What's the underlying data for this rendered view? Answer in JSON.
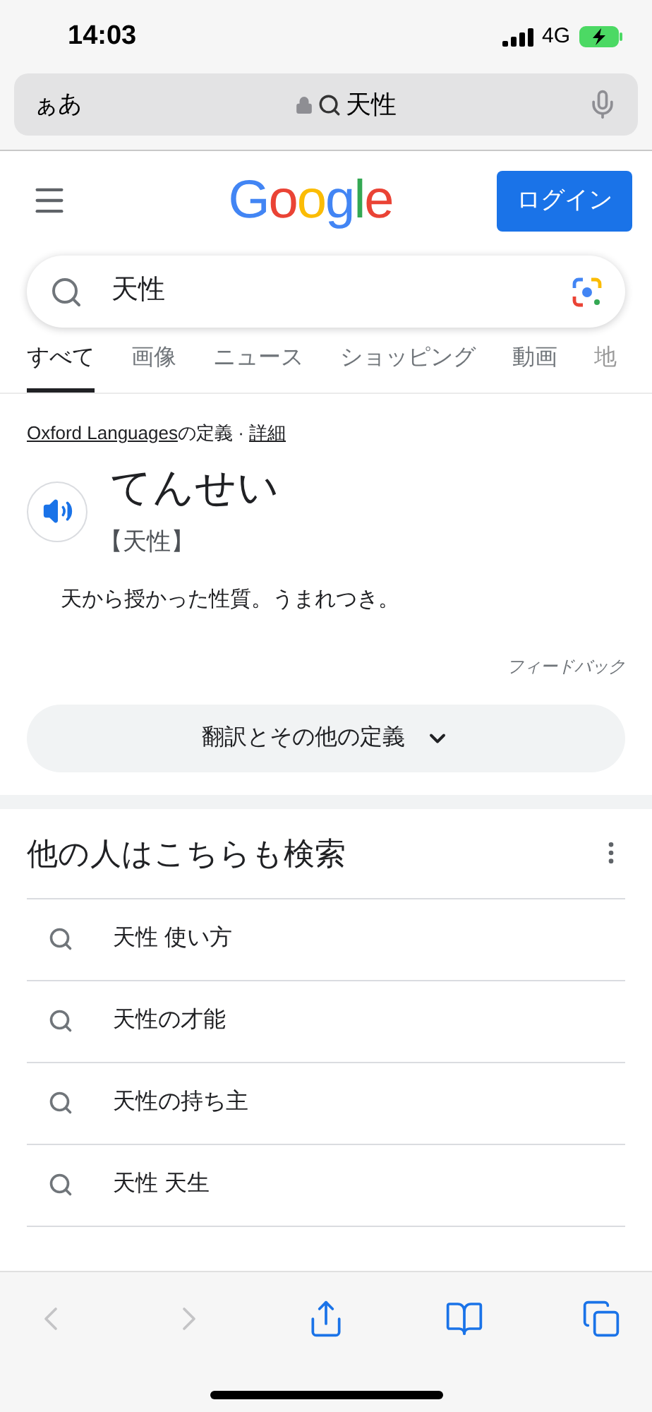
{
  "status_bar": {
    "time": "14:03",
    "network": "4G"
  },
  "address_bar": {
    "text_size_button": "ぁあ",
    "url_text": "天性"
  },
  "header": {
    "logo": [
      {
        "letter": "G",
        "color": "#4285f4"
      },
      {
        "letter": "o",
        "color": "#ea4335"
      },
      {
        "letter": "o",
        "color": "#fbbc05"
      },
      {
        "letter": "g",
        "color": "#4285f4"
      },
      {
        "letter": "l",
        "color": "#34a853"
      },
      {
        "letter": "e",
        "color": "#ea4335"
      }
    ],
    "login_button": "ログイン"
  },
  "search": {
    "value": "天性"
  },
  "tabs": [
    {
      "label": "すべて",
      "selected": true,
      "faded": false
    },
    {
      "label": "画像",
      "selected": false,
      "faded": false
    },
    {
      "label": "ニュース",
      "selected": false,
      "faded": false
    },
    {
      "label": "ショッピング",
      "selected": false,
      "faded": false
    },
    {
      "label": "動画",
      "selected": false,
      "faded": false
    },
    {
      "label": "地",
      "selected": false,
      "faded": true
    }
  ],
  "definition": {
    "source_link": "Oxford Languages",
    "source_suffix": "の定義 · ",
    "details_link": "詳細",
    "reading": "てんせい",
    "kanji": "【天性】",
    "meaning": "天から授かった性質。うまれつき。",
    "feedback": "フィードバック",
    "more_button": "翻訳とその他の定義"
  },
  "related": {
    "title": "他の人はこちらも検索",
    "items": [
      "天性 使い方",
      "天性の才能",
      "天性の持ち主",
      "天性 天生"
    ]
  },
  "toolbar": [
    {
      "kind": "back",
      "disabled": true
    },
    {
      "kind": "forward",
      "disabled": true
    },
    {
      "kind": "share",
      "disabled": false
    },
    {
      "kind": "bookmarks",
      "disabled": false
    },
    {
      "kind": "tabs",
      "disabled": false
    }
  ]
}
